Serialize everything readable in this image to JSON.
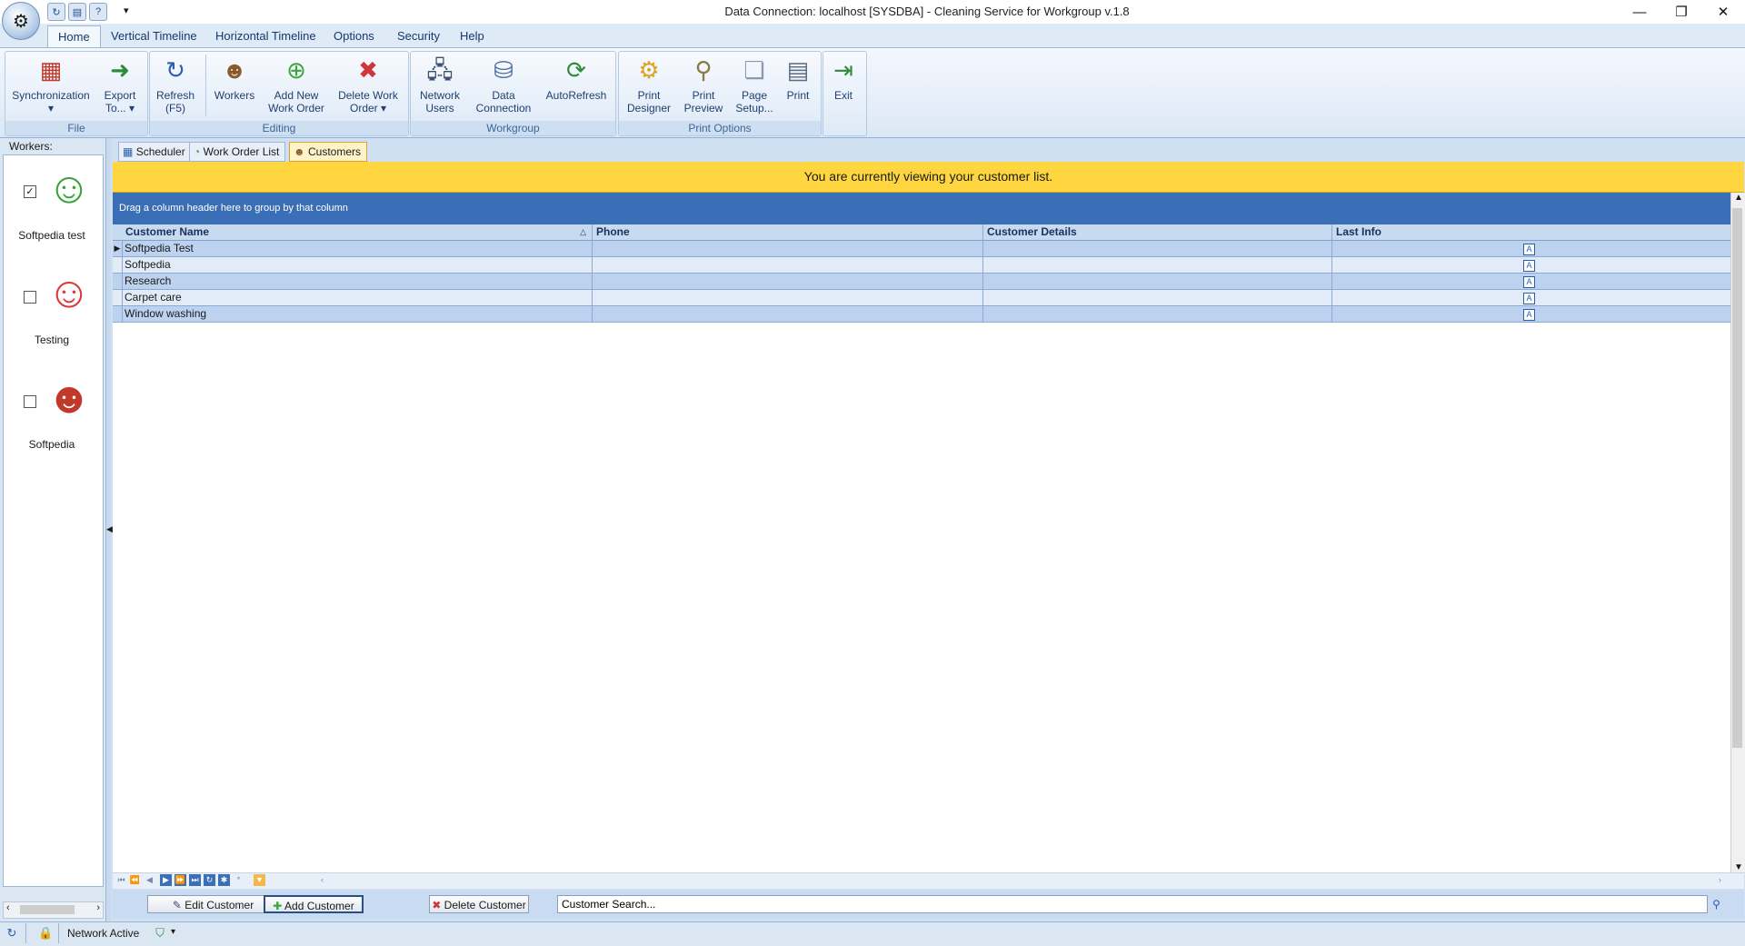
{
  "window": {
    "title": "Data Connection: localhost [SYSDBA] - Cleaning Service for Workgroup v.1.8",
    "minimize": "—",
    "restore": "❐",
    "close": "✕"
  },
  "quick_access": {
    "more": "▾"
  },
  "ribbon_tabs": [
    "Home",
    "Vertical Timeline",
    "Horizontal Timeline",
    "Options",
    "Security",
    "Help"
  ],
  "ribbon": {
    "groups": {
      "file": "File",
      "editing": "Editing",
      "workgroup": "Workgroup",
      "print_options": "Print Options"
    },
    "buttons": {
      "synchronization": [
        "Synchronization",
        "▾"
      ],
      "export": [
        "Export",
        "To... ▾"
      ],
      "refresh": [
        "Refresh",
        "(F5)"
      ],
      "workers": [
        "Workers",
        ""
      ],
      "add_work_order": [
        "Add New",
        "Work Order"
      ],
      "delete_work_order": [
        "Delete Work",
        "Order ▾"
      ],
      "network_users": [
        "Network",
        "Users"
      ],
      "data_connection": [
        "Data",
        "Connection"
      ],
      "autorefresh": [
        "AutoRefresh",
        ""
      ],
      "print_designer": [
        "Print",
        "Designer"
      ],
      "print_preview": [
        "Print",
        "Preview"
      ],
      "page_setup": [
        "Page",
        "Setup..."
      ],
      "print": [
        "Print",
        ""
      ],
      "exit": [
        "Exit",
        ""
      ]
    }
  },
  "workers_panel": {
    "label": "Workers:",
    "workers": [
      {
        "name": "Softpedia test",
        "checked": true
      },
      {
        "name": "Testing",
        "checked": false
      },
      {
        "name": "Softpedia",
        "checked": false
      }
    ]
  },
  "doc_tabs": [
    "Scheduler",
    "Work Order List",
    "Customers"
  ],
  "banner": "You are currently viewing your customer list.",
  "grid": {
    "group_hint": "Drag a column header here to group by that column",
    "columns": [
      "Customer Name",
      "Phone",
      "Customer Details",
      "Last Info"
    ],
    "rows": [
      [
        "Softpedia Test",
        "",
        "",
        ""
      ],
      [
        "Softpedia",
        "",
        "",
        ""
      ],
      [
        "Research",
        "",
        "",
        ""
      ],
      [
        "Carpet care",
        "",
        "",
        ""
      ],
      [
        "Window washing",
        "",
        "",
        ""
      ]
    ]
  },
  "actions": {
    "edit": "Edit Customer",
    "add": "Add Customer",
    "delete": "Delete Customer",
    "search_value": "Customer Search..."
  },
  "status": {
    "network": "Network Active"
  },
  "colors": {
    "banner": "#ffd640",
    "group_panel": "#3a6fb7",
    "grid_row_alt": "#d9e6f6"
  }
}
